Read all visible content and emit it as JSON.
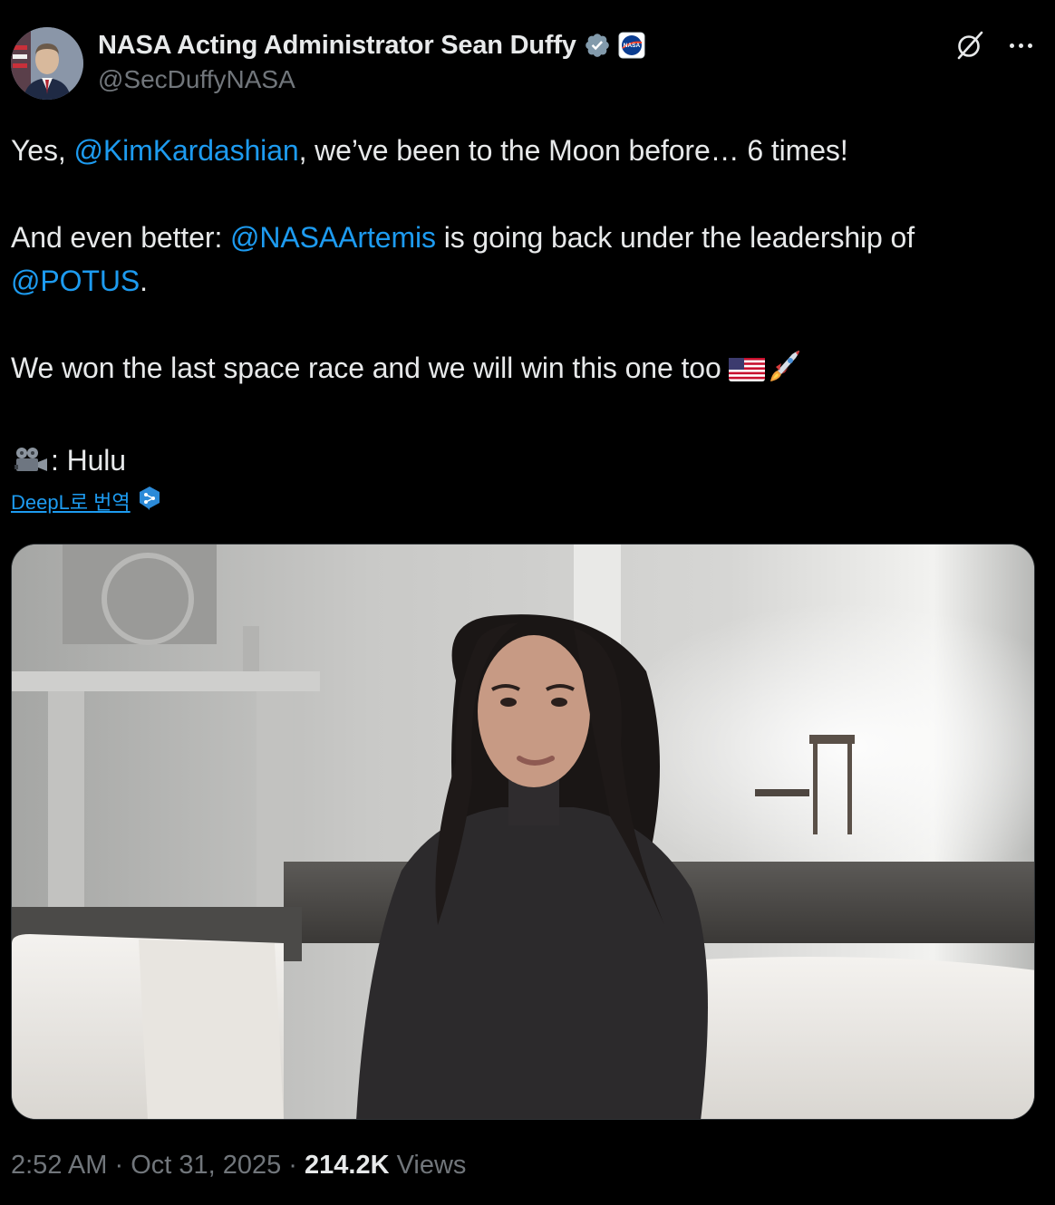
{
  "author": {
    "display_name": "NASA Acting Administrator Sean Duffy",
    "handle": "@SecDuffyNASA",
    "verified_icon": "verified-badge-icon",
    "affiliate_icon": "nasa-logo-icon",
    "avatar_icon": "profile-photo"
  },
  "actions": {
    "grok_icon": "grok-icon",
    "more_icon": "more-options-icon"
  },
  "tweet": {
    "line1_prefix": "Yes, ",
    "line1_mention": "@KimKardashian",
    "line1_suffix": ", we’ve been to the Moon before… 6 times!",
    "line2_prefix": "And even better: ",
    "line2_mention": "@NASAArtemis",
    "line2_suffix": " is going back under the leadership of",
    "line3_mention": "@POTUS",
    "line3_suffix": ".",
    "line4_text": "We won the last space race and we will win this one too ",
    "line4_emojis": [
      "us-flag-emoji",
      "rocket-emoji"
    ],
    "line5_emoji": "movie-camera-emoji",
    "line5_text": ": Hulu"
  },
  "translate": {
    "label": "DeepL로 번역",
    "icon": "deepl-icon"
  },
  "media": {
    "type": "video-frame",
    "icon": "video-thumbnail"
  },
  "meta": {
    "time": "2:52 AM",
    "sep1": " · ",
    "date": "Oct 31, 2025",
    "sep2": " · ",
    "views_count": "214.2K",
    "views_label": " Views"
  },
  "colors": {
    "background": "#000000",
    "text": "#e7e9ea",
    "secondary": "#71767b",
    "link": "#1d9bf0",
    "verified": "#829aab"
  }
}
